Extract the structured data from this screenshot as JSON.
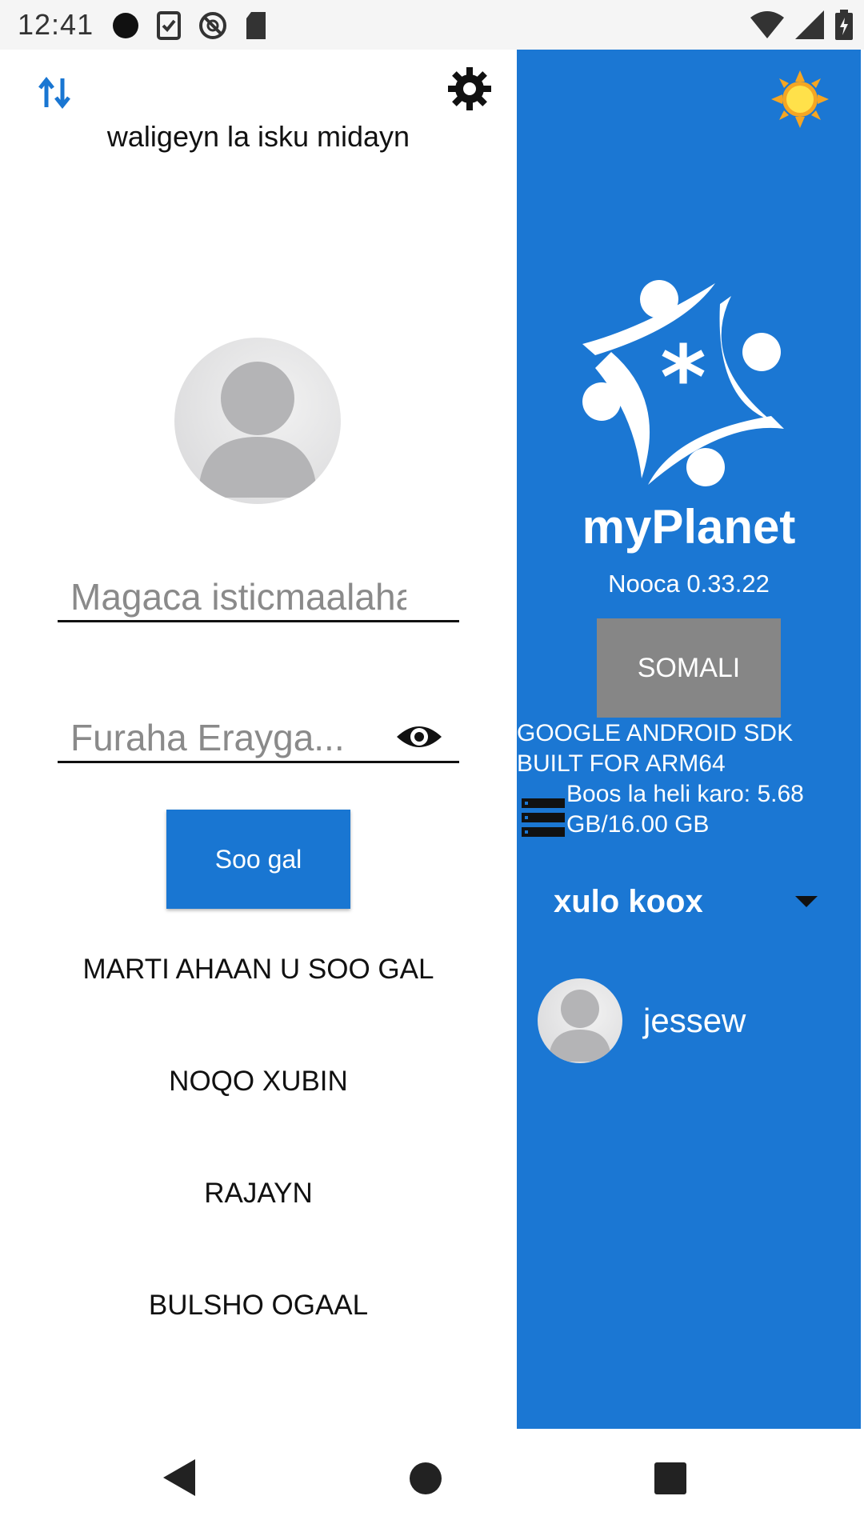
{
  "status_bar": {
    "time": "12:41",
    "icons": [
      "circle-icon",
      "task-icon",
      "vpn-icon",
      "sd-card-icon"
    ],
    "right_icons": [
      "wifi-icon",
      "signal-icon",
      "battery-icon"
    ]
  },
  "left_panel": {
    "welcome": "waligeyn la isku midayn",
    "username_placeholder": "Magaca isticmaalaha",
    "password_placeholder": "Furaha Erayga...",
    "login_button": "Soo gal",
    "links": [
      "MARTI AHAAN U SOO GAL",
      "NOQO XUBIN",
      "RAJAYN",
      "BULSHO OGAAL"
    ]
  },
  "right_panel": {
    "app_name": "myPlanet",
    "version": "Nooca 0.33.22",
    "language_button": "SOMALI",
    "device": "GOOGLE ANDROID SDK BUILT FOR ARM64",
    "storage": "Boos la heli karo: 5.68 GB/16.00 GB",
    "team_select": "xulo koox",
    "user": "jessew"
  },
  "colors": {
    "accent": "#1976d2",
    "panel": "#1b77d3",
    "language_button": "#868686"
  }
}
